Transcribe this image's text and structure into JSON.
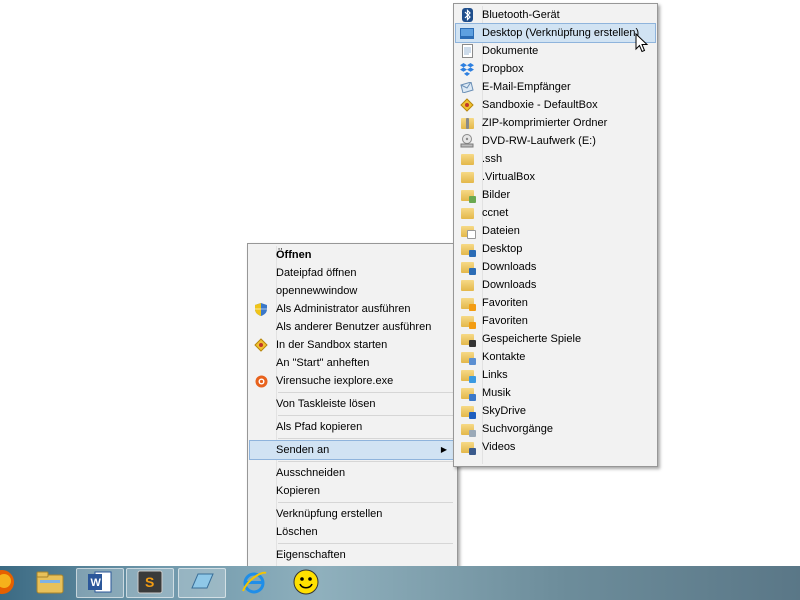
{
  "context_menu": {
    "items": [
      {
        "label": "Öffnen"
      },
      {
        "label": "Dateipfad öffnen"
      },
      {
        "label": "opennewwindow"
      },
      {
        "label": "Als Administrator ausführen"
      },
      {
        "label": "Als anderer Benutzer ausführen"
      },
      {
        "label": "In der Sandbox starten"
      },
      {
        "label": "An \"Start\" anheften"
      },
      {
        "label": "Virensuche iexplore.exe"
      },
      {
        "label": "Von Taskleiste lösen"
      },
      {
        "label": "Als Pfad kopieren"
      },
      {
        "label": "Senden an"
      },
      {
        "label": "Ausschneiden"
      },
      {
        "label": "Kopieren"
      },
      {
        "label": "Verknüpfung erstellen"
      },
      {
        "label": "Löschen"
      },
      {
        "label": "Eigenschaften"
      }
    ]
  },
  "send_to_menu": {
    "items": [
      {
        "label": "Bluetooth-Gerät"
      },
      {
        "label": "Desktop (Verknüpfung erstellen)"
      },
      {
        "label": "Dokumente"
      },
      {
        "label": "Dropbox"
      },
      {
        "label": "E-Mail-Empfänger"
      },
      {
        "label": "Sandboxie - DefaultBox"
      },
      {
        "label": "ZIP-komprimierter Ordner"
      },
      {
        "label": "DVD-RW-Laufwerk (E:)"
      },
      {
        "label": ".ssh"
      },
      {
        "label": ".VirtualBox"
      },
      {
        "label": "Bilder"
      },
      {
        "label": "ccnet"
      },
      {
        "label": "Dateien"
      },
      {
        "label": "Desktop"
      },
      {
        "label": "Downloads"
      },
      {
        "label": "Downloads"
      },
      {
        "label": "Favoriten"
      },
      {
        "label": "Favoriten"
      },
      {
        "label": "Gespeicherte Spiele"
      },
      {
        "label": "Kontakte"
      },
      {
        "label": "Links"
      },
      {
        "label": "Musik"
      },
      {
        "label": "SkyDrive"
      },
      {
        "label": "Suchvorgänge"
      },
      {
        "label": "Videos"
      }
    ]
  },
  "taskbar": {
    "buttons": [
      {
        "icon": "firefox-icon"
      },
      {
        "icon": "explorer-icon"
      },
      {
        "icon": "word-icon"
      },
      {
        "icon": "sublime-icon"
      },
      {
        "icon": "window-icon"
      },
      {
        "icon": "internet-explorer-icon"
      },
      {
        "icon": "smiley-icon"
      }
    ]
  },
  "colors": {
    "menu_bg": "#f2f2f2",
    "selected_bg": "#d1e3f3",
    "selected_border": "#8fb4dc",
    "folder": "#e3b74a"
  }
}
